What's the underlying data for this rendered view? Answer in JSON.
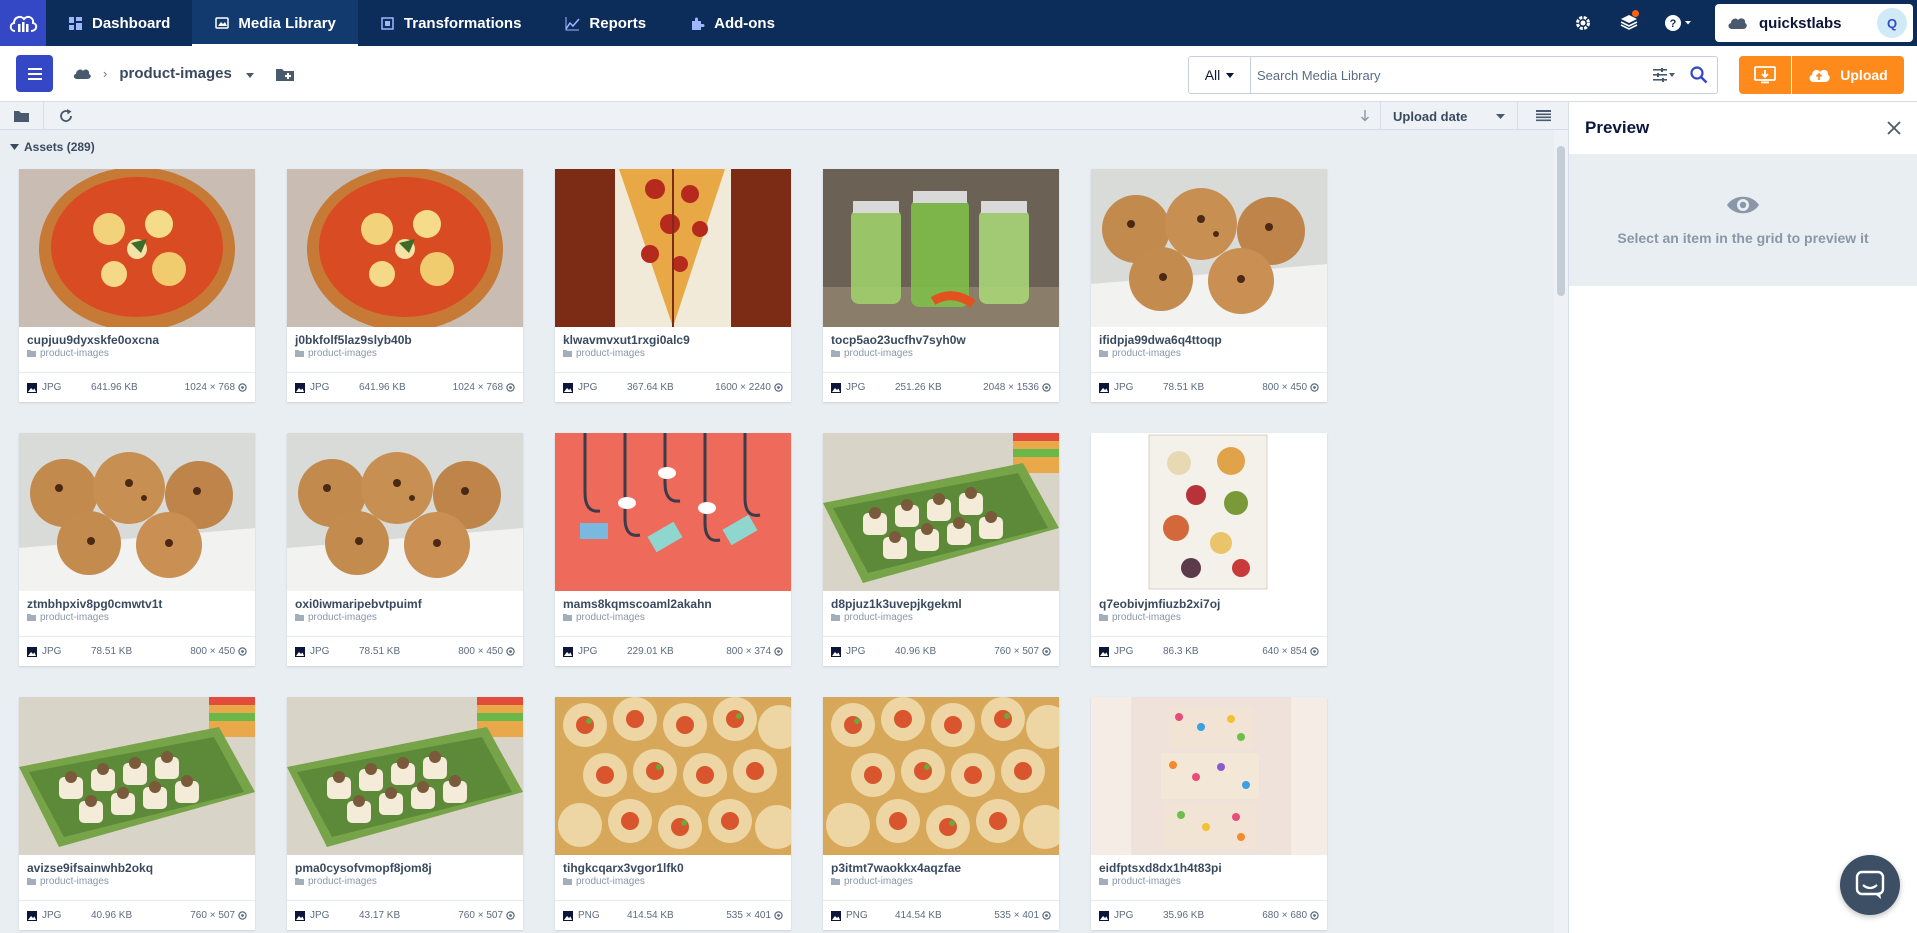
{
  "nav": {
    "items": [
      {
        "label": "Dashboard",
        "icon": "dashboard-icon"
      },
      {
        "label": "Media Library",
        "icon": "media-library-icon"
      },
      {
        "label": "Transformations",
        "icon": "transformations-icon"
      },
      {
        "label": "Reports",
        "icon": "reports-icon"
      },
      {
        "label": "Add-ons",
        "icon": "addons-icon"
      }
    ],
    "active": "Media Library",
    "account_name": "quickstlabs",
    "avatar_initial": "Q"
  },
  "toolbar": {
    "folder": "product-images",
    "search_type": "All",
    "search_placeholder": "Search Media Library",
    "upload_label": "Upload"
  },
  "gridbar": {
    "sort_label": "Upload date"
  },
  "assets": {
    "header": "Assets (289)",
    "items": [
      {
        "name": "cupjuu9dyxskfe0oxcna",
        "folder": "product-images",
        "type": "JPG",
        "size": "641.96 KB",
        "dims": "1024 × 768",
        "kind": "pizza"
      },
      {
        "name": "j0bkfolf5laz9slyb40b",
        "folder": "product-images",
        "type": "JPG",
        "size": "641.96 KB",
        "dims": "1024 × 768",
        "kind": "pizza"
      },
      {
        "name": "klwavmvxut1rxgi0alc9",
        "folder": "product-images",
        "type": "JPG",
        "size": "367.64 KB",
        "dims": "1600 × 2240",
        "kind": "pepperoni"
      },
      {
        "name": "tocp5ao23ucfhv7syh0w",
        "folder": "product-images",
        "type": "JPG",
        "size": "251.26 KB",
        "dims": "2048 × 1536",
        "kind": "pickles"
      },
      {
        "name": "ifidpja99dwa6q4ttoqp",
        "folder": "product-images",
        "type": "JPG",
        "size": "78.51 KB",
        "dims": "800 × 450",
        "kind": "cookies"
      },
      {
        "name": "ztmbhpxiv8pg0cmwtv1t",
        "folder": "product-images",
        "type": "JPG",
        "size": "78.51 KB",
        "dims": "800 × 450",
        "kind": "cookies"
      },
      {
        "name": "oxi0iwmaripebvtpuimf",
        "folder": "product-images",
        "type": "JPG",
        "size": "78.51 KB",
        "dims": "800 × 450",
        "kind": "cookies"
      },
      {
        "name": "mams8kqmscoaml2akahn",
        "folder": "product-images",
        "type": "JPG",
        "size": "229.01 KB",
        "dims": "800 × 374",
        "kind": "phishing"
      },
      {
        "name": "d8pjuz1k3uvepjkgekml",
        "folder": "product-images",
        "type": "JPG",
        "size": "40.96 KB",
        "dims": "760 × 507",
        "kind": "sushi"
      },
      {
        "name": "q7eobivjmfiuzb2xi7oj",
        "folder": "product-images",
        "type": "JPG",
        "size": "86.3 KB",
        "dims": "640 × 854",
        "kind": "board"
      },
      {
        "name": "avizse9ifsainwhb2okq",
        "folder": "product-images",
        "type": "JPG",
        "size": "40.96 KB",
        "dims": "760 × 507",
        "kind": "sushi"
      },
      {
        "name": "pma0cysofvmopf8jom8j",
        "folder": "product-images",
        "type": "JPG",
        "size": "43.17 KB",
        "dims": "760 × 507",
        "kind": "sushi"
      },
      {
        "name": "tihgkcqarx3vgor1lfk0",
        "folder": "product-images",
        "type": "PNG",
        "size": "414.54 KB",
        "dims": "535 × 401",
        "kind": "rolls"
      },
      {
        "name": "p3itmt7waokkx4aqzfae",
        "folder": "product-images",
        "type": "PNG",
        "size": "414.54 KB",
        "dims": "535 × 401",
        "kind": "rolls"
      },
      {
        "name": "eidfptsxd8dx1h4t83pi",
        "folder": "product-images",
        "type": "JPG",
        "size": "35.96 KB",
        "dims": "680 × 680",
        "kind": "cereal"
      }
    ]
  },
  "preview": {
    "title": "Preview",
    "empty_message": "Select an item in the grid to preview it"
  },
  "colors": {
    "nav_bg": "#0c2c5a",
    "brand_blue": "#3448c5",
    "upload_orange": "#ff8a1c",
    "content_bg": "#e9eef3"
  }
}
